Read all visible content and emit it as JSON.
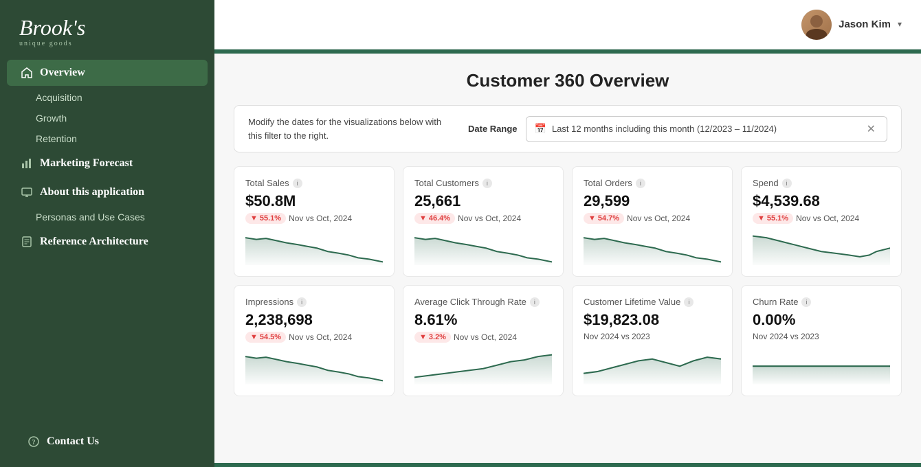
{
  "app": {
    "logo": "Brook's",
    "logo_sub": "unique goods"
  },
  "sidebar": {
    "nav": [
      {
        "id": "overview",
        "label": "Overview",
        "icon": "home-icon",
        "active": true,
        "children": [
          {
            "id": "acquisition",
            "label": "Acquisition"
          },
          {
            "id": "growth",
            "label": "Growth"
          },
          {
            "id": "retention",
            "label": "Retention"
          }
        ]
      },
      {
        "id": "marketing-forecast",
        "label": "Marketing Forecast",
        "icon": "chart-icon",
        "active": false,
        "children": []
      },
      {
        "id": "about",
        "label": "About this application",
        "icon": "monitor-icon",
        "active": false,
        "children": [
          {
            "id": "personas",
            "label": "Personas and Use Cases"
          }
        ]
      },
      {
        "id": "reference",
        "label": "Reference Architecture",
        "icon": "doc-icon",
        "active": false,
        "children": []
      }
    ],
    "bottom": [
      {
        "id": "contact",
        "label": "Contact Us",
        "icon": "help-icon"
      }
    ]
  },
  "header": {
    "user_name": "Jason Kim",
    "chevron": "▾"
  },
  "page": {
    "title": "Customer 360 Overview",
    "filter": {
      "description": "Modify the dates for the visualizations below with this filter to the right.",
      "label": "Date Range",
      "value": "Last 12 months including this month (12/2023 – 11/2024)"
    },
    "metrics_row1": [
      {
        "title": "Total Sales",
        "value": "$50.8M",
        "change_pct": "55.1%",
        "change_label": "Nov vs Oct, 2024",
        "direction": "down",
        "sparkline_type": "decline"
      },
      {
        "title": "Total Customers",
        "value": "25,661",
        "change_pct": "46.4%",
        "change_label": "Nov vs Oct, 2024",
        "direction": "down",
        "sparkline_type": "decline"
      },
      {
        "title": "Total Orders",
        "value": "29,599",
        "change_pct": "54.7%",
        "change_label": "Nov vs Oct, 2024",
        "direction": "down",
        "sparkline_type": "decline"
      },
      {
        "title": "Spend",
        "value": "$4,539.68",
        "change_pct": "55.1%",
        "change_label": "Nov vs Oct, 2024",
        "direction": "down",
        "sparkline_type": "decline-end-up"
      }
    ],
    "metrics_row2": [
      {
        "title": "Impressions",
        "value": "2,238,698",
        "change_pct": "54.5%",
        "change_label": "Nov vs Oct, 2024",
        "direction": "down",
        "sparkline_type": "decline"
      },
      {
        "title": "Average Click Through Rate",
        "value": "8.61%",
        "change_pct": "3.2%",
        "change_label": "Nov vs Oct, 2024",
        "direction": "down",
        "sparkline_type": "rise"
      },
      {
        "title": "Customer Lifetime Value",
        "value": "$19,823.08",
        "change_label": "Nov 2024 vs 2023",
        "direction": "neutral",
        "sparkline_type": "rise-dip"
      },
      {
        "title": "Churn Rate",
        "value": "0.00%",
        "change_label": "Nov 2024 vs 2023",
        "direction": "neutral",
        "sparkline_type": "flat"
      }
    ]
  }
}
